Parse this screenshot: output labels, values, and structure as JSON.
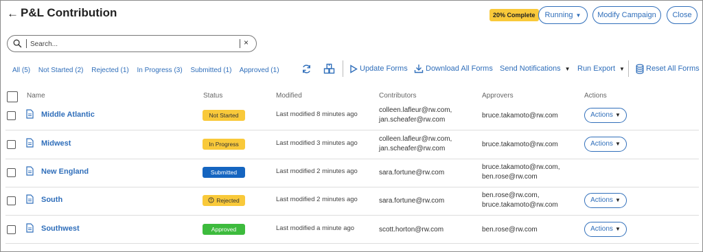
{
  "header": {
    "back_glyph": "←",
    "title": "P&L Contribution",
    "progress_badge": "20% Complete",
    "running_label": "Running",
    "modify_label": "Modify Campaign",
    "close_label": "Close"
  },
  "search": {
    "placeholder": "Search...",
    "clear_glyph": "×"
  },
  "filters": [
    "All (5)",
    "Not Started (2)",
    "Rejected (1)",
    "In Progress (3)",
    "Submitted (1)",
    "Approved (1)"
  ],
  "toolbar": {
    "update_forms": "Update Forms",
    "download_all_forms": "Download All Forms",
    "send_notifications": "Send Notifications",
    "run_export": "Run Export",
    "reset_all_forms": "Reset All Forms"
  },
  "table": {
    "columns": [
      "Name",
      "Status",
      "Modified",
      "Contributors",
      "Approvers",
      "Actions"
    ],
    "rows": [
      {
        "name": "Middle Atlantic",
        "status": "Not Started",
        "modified": "Last modified 8 minutes ago",
        "contributors": [
          "colleen.lafleur@rw.com,",
          "jan.scheafer@rw.com"
        ],
        "approvers": [
          "bruce.takamoto@rw.com"
        ],
        "actions": "Actions"
      },
      {
        "name": "Midwest",
        "status": "In Progress",
        "modified": "Last modified 3 minutes ago",
        "contributors": [
          "colleen.lafleur@rw.com,",
          "jan.scheafer@rw.com"
        ],
        "approvers": [
          "bruce.takamoto@rw.com"
        ],
        "actions": "Actions"
      },
      {
        "name": "New England",
        "status": "Submitted",
        "modified": "Last modified 2 minutes ago",
        "contributors": [
          "sara.fortune@rw.com"
        ],
        "approvers": [
          "bruce.takamoto@rw.com,",
          "ben.rose@rw.com"
        ],
        "actions": "Actions"
      },
      {
        "name": "South",
        "status": "Rejected",
        "modified": "Last modified 2 minutes ago",
        "contributors": [
          "sara.fortune@rw.com"
        ],
        "approvers": [
          "ben.rose@rw.com,",
          "bruce.takamoto@rw.com"
        ],
        "actions": "Actions"
      },
      {
        "name": "Southwest",
        "status": "Approved",
        "modified": "Last modified a minute ago",
        "contributors": [
          "scott.horton@rw.com"
        ],
        "approvers": [
          "ben.rose@rw.com"
        ],
        "actions": "Actions"
      }
    ]
  },
  "colors": {
    "accent": "#2f6eba",
    "status_yellow": "#f9c93a",
    "status_blue": "#1565c0",
    "status_green": "#3dbb3d"
  }
}
